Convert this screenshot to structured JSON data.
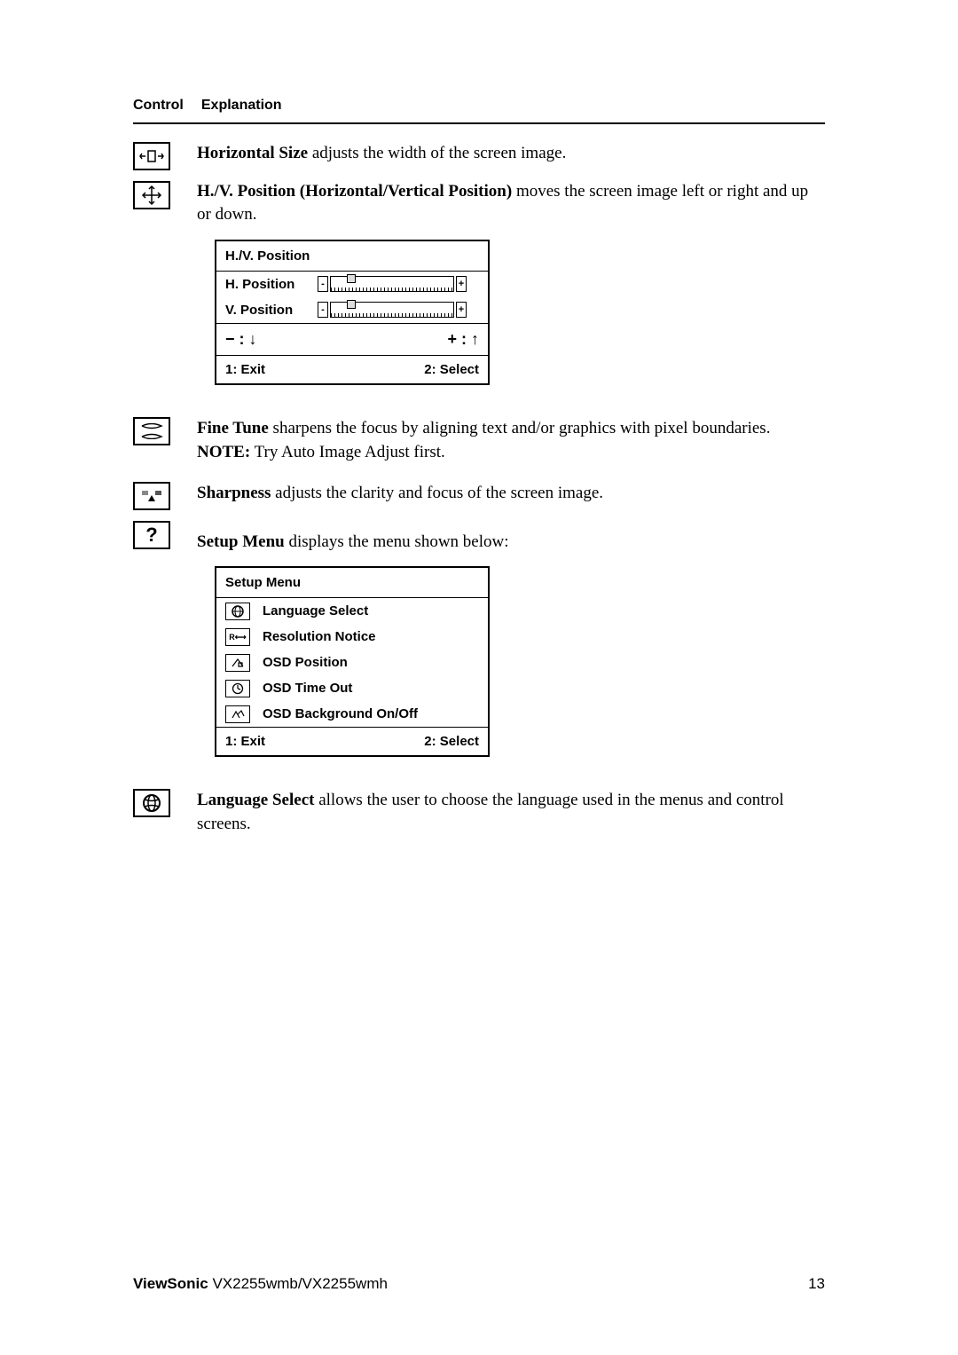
{
  "header": {
    "col1": "Control",
    "col2": "Explanation"
  },
  "items": {
    "hsize": {
      "title": "Horizontal Size",
      "text": " adjusts the width of the screen image."
    },
    "hvpos": {
      "title": "H./V. Position (Horizontal/Vertical Position)",
      "text": " moves the screen image left or right and up or down."
    },
    "finetune": {
      "title": "Fine Tune",
      "text": " sharpens the focus by aligning text and/or graphics with pixel boundaries.",
      "note_label": "NOTE:",
      "note_text": " Try Auto Image Adjust first."
    },
    "sharpness": {
      "title": "Sharpness",
      "text": " adjusts the clarity and focus of the screen image."
    },
    "setupmenu": {
      "title": "Setup Menu",
      "text": " displays the menu shown below:"
    },
    "langsel": {
      "title": "Language Select",
      "text": " allows the user to choose the language used in the menus and control screens."
    }
  },
  "hvpanel": {
    "title": "H./V. Position",
    "row1": "H. Position",
    "row2": "V. Position",
    "minus": "− : ",
    "plus": "+ : ",
    "slider_minus": "-",
    "slider_plus": "+",
    "exit": "1: Exit",
    "select": "2: Select"
  },
  "setuppanel": {
    "title": "Setup Menu",
    "rows": {
      "0": "Language Select",
      "1": "Resolution Notice",
      "2": "OSD Position",
      "3": "OSD Time Out",
      "4": "OSD Background On/Off"
    },
    "exit": "1: Exit",
    "select": "2: Select"
  },
  "footer": {
    "brand": "ViewSonic",
    "model": "  VX2255wmb/VX2255wmh",
    "page": "13"
  }
}
